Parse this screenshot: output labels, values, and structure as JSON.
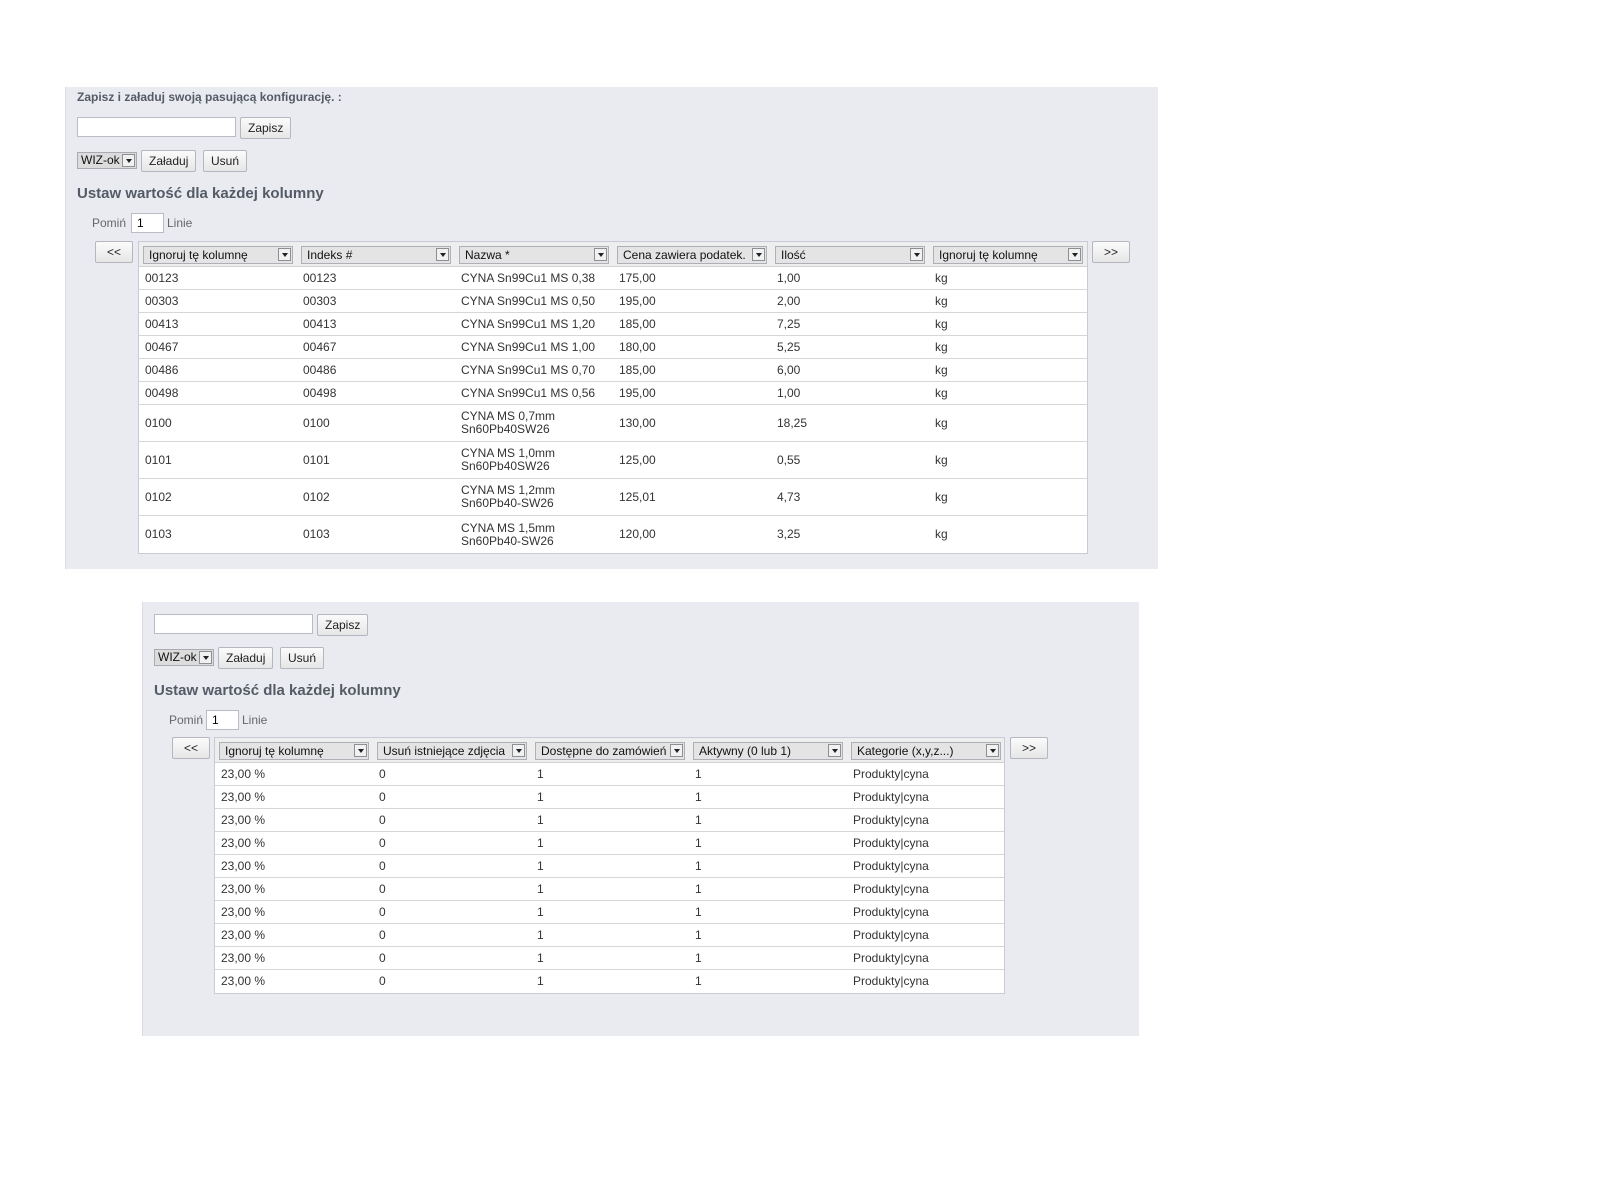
{
  "panel1": {
    "config_label": "Zapisz i załaduj swoją pasującą konfigurację. :",
    "save_name_value": "",
    "save_button": "Zapisz",
    "config_select": "WIZ-ok",
    "load_button": "Załaduj",
    "delete_button": "Usuń",
    "section_title": "Ustaw wartość dla każdej kolumny",
    "skip_label": "Pomiń",
    "skip_value": "1",
    "lines_label": "Linie",
    "prev_button": "<<",
    "next_button": ">>",
    "columns": [
      "Ignoruj tę kolumnę",
      "Indeks #",
      "Nazwa *",
      "Cena zawiera podatek.",
      "Ilość",
      "Ignoruj tę kolumnę"
    ],
    "rows": [
      [
        "00123",
        "00123",
        "CYNA Sn99Cu1 MS 0,38",
        "",
        "175,00",
        "1,00",
        "kg"
      ],
      [
        "00303",
        "00303",
        "CYNA Sn99Cu1 MS 0,50",
        "",
        "195,00",
        "2,00",
        "kg"
      ],
      [
        "00413",
        "00413",
        "CYNA Sn99Cu1 MS 1,20",
        "",
        "185,00",
        "7,25",
        "kg"
      ],
      [
        "00467",
        "00467",
        "CYNA Sn99Cu1 MS 1,00",
        "",
        "180,00",
        "5,25",
        "kg"
      ],
      [
        "00486",
        "00486",
        "CYNA Sn99Cu1 MS 0,70",
        "",
        "185,00",
        "6,00",
        "kg"
      ],
      [
        "00498",
        "00498",
        "CYNA Sn99Cu1 MS 0,56",
        "",
        "195,00",
        "1,00",
        "kg"
      ],
      [
        "0100",
        "0100",
        "CYNA MS 0,7mm",
        "Sn60Pb40SW26",
        "130,00",
        "18,25",
        "kg"
      ],
      [
        "0101",
        "0101",
        "CYNA MS 1,0mm",
        "Sn60Pb40SW26",
        "125,00",
        "0,55",
        "kg"
      ],
      [
        "0102",
        "0102",
        "CYNA MS 1,2mm",
        "Sn60Pb40-SW26",
        "125,01",
        "4,73",
        "kg"
      ],
      [
        "0103",
        "0103",
        "CYNA MS 1,5mm",
        "Sn60Pb40-SW26",
        "120,00",
        "3,25",
        "kg"
      ]
    ]
  },
  "panel2": {
    "save_name_value": "",
    "save_button": "Zapisz",
    "config_select": "WIZ-ok",
    "load_button": "Załaduj",
    "delete_button": "Usuń",
    "section_title": "Ustaw wartość dla każdej kolumny",
    "skip_label": "Pomiń",
    "skip_value": "1",
    "lines_label": "Linie",
    "prev_button": "<<",
    "next_button": ">>",
    "columns": [
      "Ignoruj tę kolumnę",
      "Usuń istniejące zdjęcia",
      "Dostępne do zamówień",
      "Aktywny (0 lub 1)",
      "Kategorie (x,y,z...)"
    ],
    "rows": [
      [
        "23,00 %",
        "0",
        "1",
        "1",
        "Produkty|cyna"
      ],
      [
        "23,00 %",
        "0",
        "1",
        "1",
        "Produkty|cyna"
      ],
      [
        "23,00 %",
        "0",
        "1",
        "1",
        "Produkty|cyna"
      ],
      [
        "23,00 %",
        "0",
        "1",
        "1",
        "Produkty|cyna"
      ],
      [
        "23,00 %",
        "0",
        "1",
        "1",
        "Produkty|cyna"
      ],
      [
        "23,00 %",
        "0",
        "1",
        "1",
        "Produkty|cyna"
      ],
      [
        "23,00 %",
        "0",
        "1",
        "1",
        "Produkty|cyna"
      ],
      [
        "23,00 %",
        "0",
        "1",
        "1",
        "Produkty|cyna"
      ],
      [
        "23,00 %",
        "0",
        "1",
        "1",
        "Produkty|cyna"
      ],
      [
        "23,00 %",
        "0",
        "1",
        "1",
        "Produkty|cyna"
      ]
    ]
  }
}
